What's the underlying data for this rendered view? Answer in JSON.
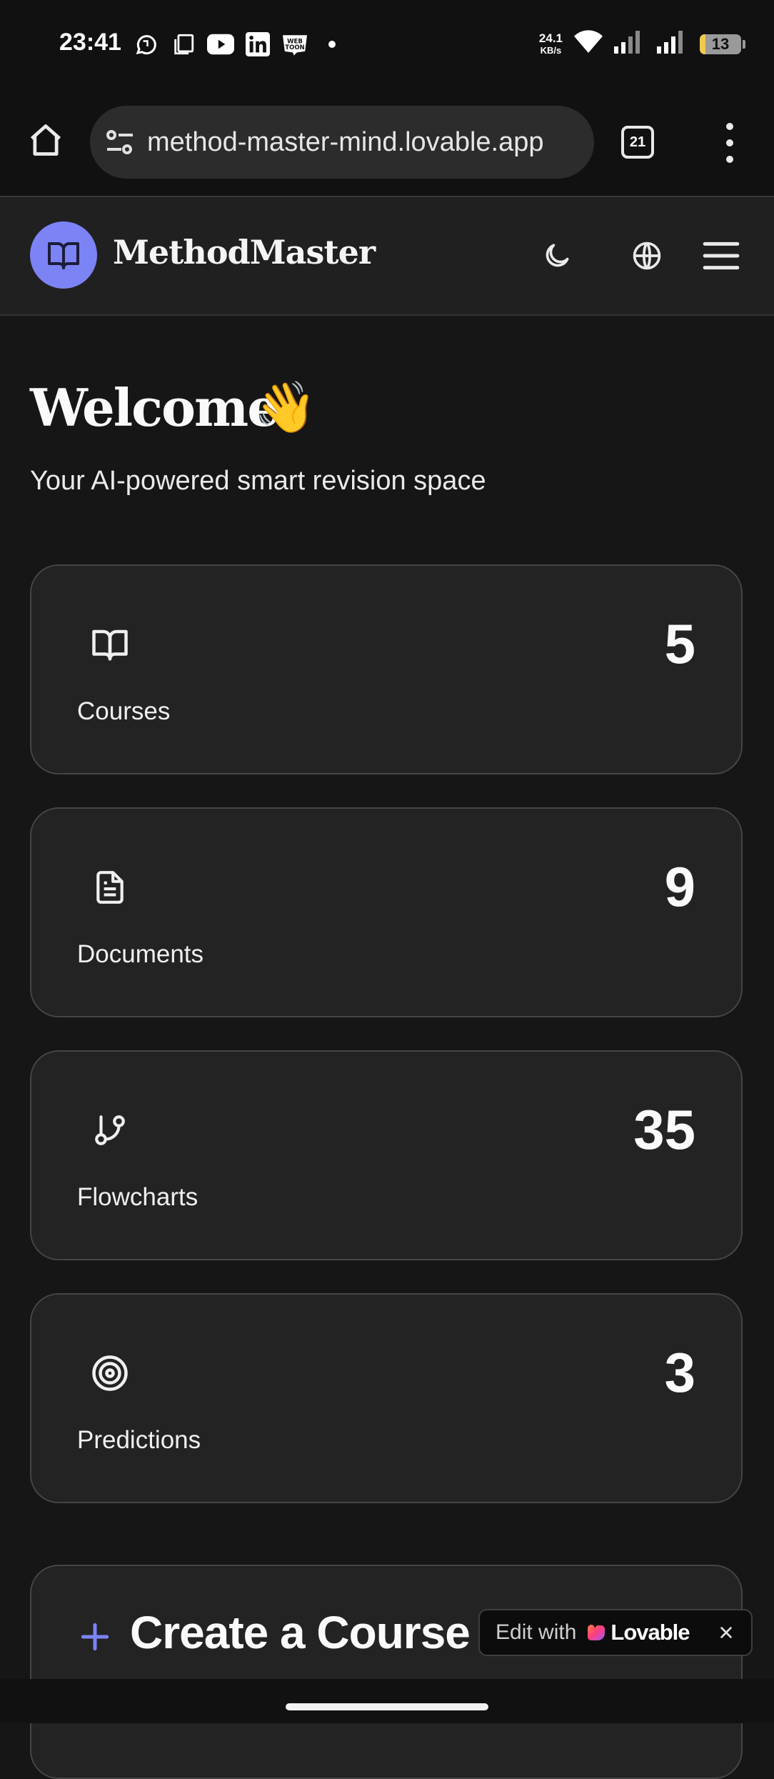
{
  "status_bar": {
    "time": "23:41",
    "icons": [
      "whatsapp-business-icon",
      "copy-icon",
      "youtube-icon",
      "linkedin-icon",
      "webtoon-icon",
      "dot-icon"
    ],
    "net_speed": "24.1",
    "net_unit": "KB/s",
    "battery_level": "13",
    "battery_color": "#f2c94c"
  },
  "browser": {
    "url": "method-master-mind.lovable.app",
    "tab_count": "21"
  },
  "header": {
    "brand": "MethodMaster",
    "accent": "#7b83f5"
  },
  "welcome": {
    "title": "Welcome",
    "emoji": "👋",
    "subtitle": "Your AI-powered smart revision space"
  },
  "stats": [
    {
      "label": "Courses",
      "value": "5",
      "icon": "book-icon"
    },
    {
      "label": "Documents",
      "value": "9",
      "icon": "document-icon"
    },
    {
      "label": "Flowcharts",
      "value": "35",
      "icon": "git-branch-icon"
    },
    {
      "label": "Predictions",
      "value": "3",
      "icon": "target-icon"
    }
  ],
  "create": {
    "title": "Create a Course"
  },
  "lovable": {
    "edit_label": "Edit with",
    "brand": "Lovable"
  }
}
